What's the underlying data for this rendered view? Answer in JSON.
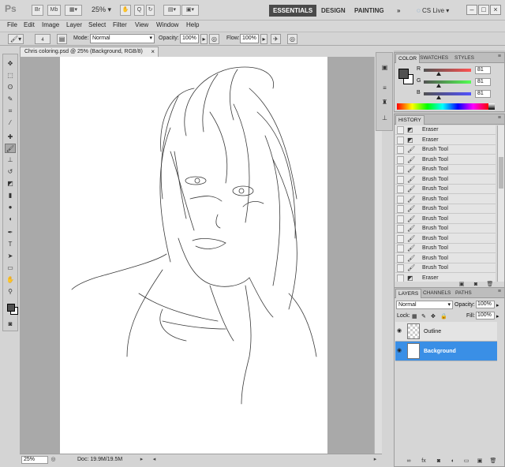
{
  "app": {
    "logo": "Ps"
  },
  "titlebar": {
    "mb_label": "Mb",
    "zoom": "25%",
    "workspaces": [
      "ESSENTIALS",
      "DESIGN",
      "PAINTING",
      "»"
    ],
    "cs_live": "CS Live",
    "window_controls": [
      "–",
      "□",
      "×"
    ]
  },
  "menu": [
    "File",
    "Edit",
    "Image",
    "Layer",
    "Select",
    "Filter",
    "View",
    "Window",
    "Help"
  ],
  "options": {
    "brush_size": "4",
    "mode_label": "Mode:",
    "mode_value": "Normal",
    "opacity_label": "Opacity:",
    "opacity_value": "100%",
    "flow_label": "Flow:",
    "flow_value": "100%"
  },
  "document": {
    "tab_title": "Chris coloring.psd @ 25% (Background, RGB/8)",
    "tab_close": "×",
    "status_zoom": "25%",
    "status_doc": "Doc: 19.9M/19.5M"
  },
  "color_panel": {
    "tabs": [
      "COLOR",
      "SWATCHES",
      "STYLES"
    ],
    "r": {
      "label": "R",
      "value": "81",
      "level": 0.32
    },
    "g": {
      "label": "G",
      "value": "81",
      "level": 0.32
    },
    "b": {
      "label": "B",
      "value": "81",
      "level": 0.32
    }
  },
  "history": {
    "tab": "HISTORY",
    "items": [
      "Eraser",
      "Eraser",
      "Brush Tool",
      "Brush Tool",
      "Brush Tool",
      "Brush Tool",
      "Brush Tool",
      "Brush Tool",
      "Brush Tool",
      "Brush Tool",
      "Brush Tool",
      "Brush Tool",
      "Brush Tool",
      "Brush Tool",
      "Brush Tool",
      "Eraser"
    ]
  },
  "layers": {
    "tabs": [
      "LAYERS",
      "CHANNELS",
      "PATHS"
    ],
    "blend_mode": "Normal",
    "opacity_label": "Opacity:",
    "opacity_value": "100%",
    "lock_label": "Lock:",
    "fill_label": "Fill:",
    "fill_value": "100%",
    "items": [
      {
        "name": "Outline",
        "selected": false
      },
      {
        "name": "Background",
        "selected": true
      }
    ]
  }
}
